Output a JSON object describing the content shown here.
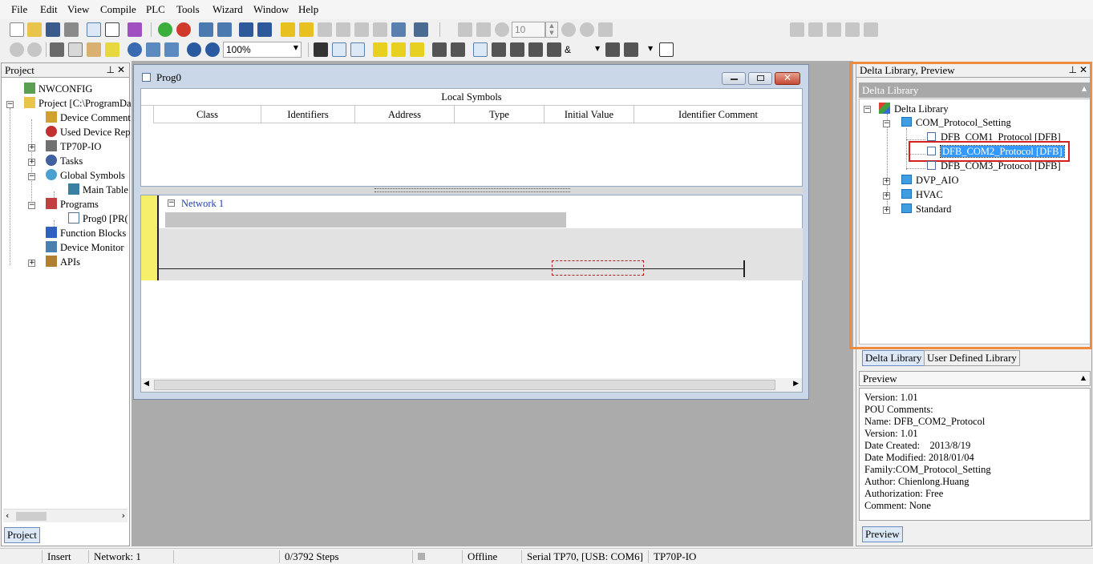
{
  "menu": [
    "File",
    "Edit",
    "View",
    "Compile",
    "PLC",
    "Tools",
    "Wizard",
    "Window",
    "Help"
  ],
  "toolbar": {
    "zoom": "100%",
    "step_value": "10",
    "operator": "&"
  },
  "project_panel": {
    "title": "Project",
    "tab": "Project",
    "tree": {
      "nwconfig": "NWCONFIG",
      "project": "Project [C:\\ProgramDa",
      "device_comment": "Device Comment",
      "used_device": "Used Device Rep",
      "tp70p_io": "TP70P-IO",
      "tasks": "Tasks",
      "global_symbols": "Global Symbols",
      "main_table": "Main Table",
      "programs": "Programs",
      "prog0": "Prog0 [PR(",
      "function_blocks": "Function Blocks",
      "device_monitor": "Device Monitor",
      "apis": "APIs"
    }
  },
  "prog_window": {
    "title": "Prog0",
    "local_symbols": "Local Symbols",
    "columns": [
      "Class",
      "Identifiers",
      "Address",
      "Type",
      "Initial Value",
      "Identifier Comment"
    ],
    "network_label": "Network 1"
  },
  "library_panel": {
    "title": "Delta Library, Preview",
    "section": "Delta Library",
    "tree": {
      "root": "Delta Library",
      "com_protocol": "COM_Protocol_Setting",
      "dfb_com1": "DFB_COM1_Protocol [DFB]",
      "dfb_com2": "DFB_COM2_Protocol [DFB]",
      "dfb_com3": "DFB_COM3_Protocol [DFB]",
      "dvp_aio": "DVP_AIO",
      "hvac": "HVAC",
      "standard": "Standard"
    },
    "tabs": [
      "Delta Library",
      "User Defined Library"
    ]
  },
  "preview": {
    "title": "Preview",
    "lines": [
      "Version: 1.01",
      "POU Comments:",
      "Name: DFB_COM2_Protocol",
      "Version: 1.01",
      "Date Created:    2013/8/19",
      "Date Modified: 2018/01/04",
      "Family:COM_Protocol_Setting",
      "Author: Chienlong.Huang",
      "Authorization: Free",
      "Comment: None"
    ],
    "tab": "Preview"
  },
  "status": {
    "mode": "Insert",
    "network": "Network: 1",
    "steps": "0/3792 Steps",
    "state": "Offline",
    "connection": "Serial TP70, [USB: COM6]",
    "device": "TP70P-IO"
  },
  "colors": {
    "highlight_orange": "#f08a3c",
    "highlight_red": "#d42020",
    "selection_blue": "#3399ff",
    "network_yellow": "#f5f06a"
  }
}
